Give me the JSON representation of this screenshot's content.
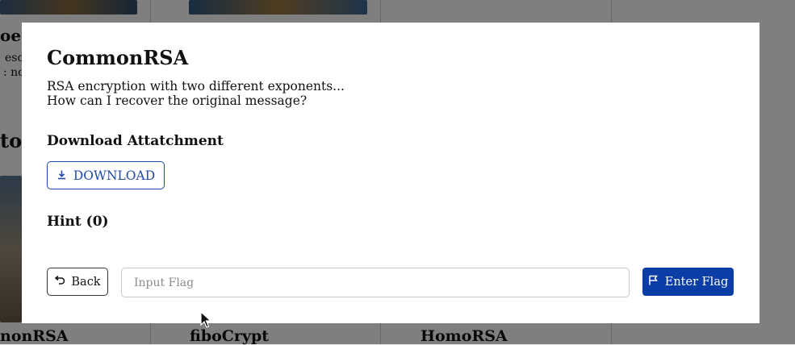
{
  "background": {
    "cards": [
      {
        "fragments": [
          "oe r",
          "esc",
          ": nc"
        ]
      },
      {
        "fragment": "to"
      },
      {
        "bottom_titles": [
          "nonRSA",
          "fiboCrypt",
          "HomoRSA"
        ]
      }
    ]
  },
  "modal": {
    "title": "CommonRSA",
    "description_line1": "RSA encryption with two different exponents...",
    "description_line2": "How can I recover the original message?",
    "attachment_heading": "Download Attatchment",
    "download_label": "DOWNLOAD",
    "hint_heading": "Hint (0)",
    "back_label": "Back",
    "flag_input": {
      "value": "",
      "placeholder": "Input Flag"
    },
    "enter_flag_label": "Enter Flag"
  },
  "icons": {
    "download": "download-icon",
    "back": "undo-arrow-icon",
    "flag": "flag-icon"
  },
  "colors": {
    "accent": "#0a3ea6",
    "outline_accent": "#1e4aa8"
  }
}
